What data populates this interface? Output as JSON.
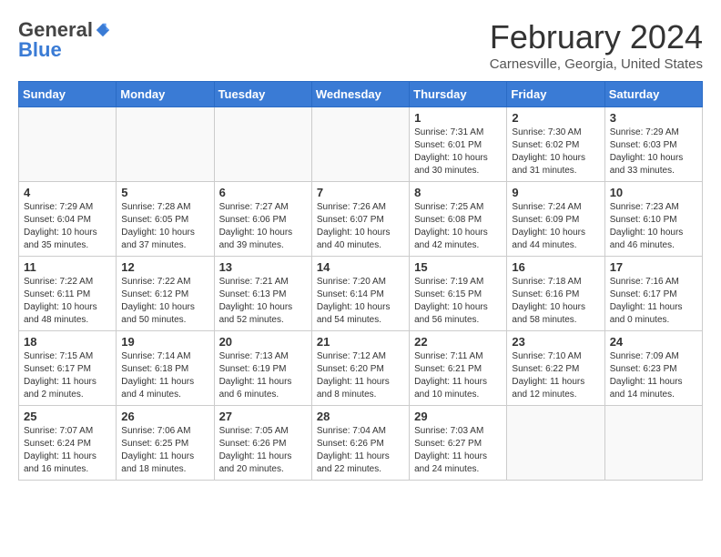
{
  "header": {
    "logo_general": "General",
    "logo_blue": "Blue",
    "month_title": "February 2024",
    "location": "Carnesville, Georgia, United States"
  },
  "weekdays": [
    "Sunday",
    "Monday",
    "Tuesday",
    "Wednesday",
    "Thursday",
    "Friday",
    "Saturday"
  ],
  "weeks": [
    [
      {
        "day": "",
        "info": ""
      },
      {
        "day": "",
        "info": ""
      },
      {
        "day": "",
        "info": ""
      },
      {
        "day": "",
        "info": ""
      },
      {
        "day": "1",
        "info": "Sunrise: 7:31 AM\nSunset: 6:01 PM\nDaylight: 10 hours\nand 30 minutes."
      },
      {
        "day": "2",
        "info": "Sunrise: 7:30 AM\nSunset: 6:02 PM\nDaylight: 10 hours\nand 31 minutes."
      },
      {
        "day": "3",
        "info": "Sunrise: 7:29 AM\nSunset: 6:03 PM\nDaylight: 10 hours\nand 33 minutes."
      }
    ],
    [
      {
        "day": "4",
        "info": "Sunrise: 7:29 AM\nSunset: 6:04 PM\nDaylight: 10 hours\nand 35 minutes."
      },
      {
        "day": "5",
        "info": "Sunrise: 7:28 AM\nSunset: 6:05 PM\nDaylight: 10 hours\nand 37 minutes."
      },
      {
        "day": "6",
        "info": "Sunrise: 7:27 AM\nSunset: 6:06 PM\nDaylight: 10 hours\nand 39 minutes."
      },
      {
        "day": "7",
        "info": "Sunrise: 7:26 AM\nSunset: 6:07 PM\nDaylight: 10 hours\nand 40 minutes."
      },
      {
        "day": "8",
        "info": "Sunrise: 7:25 AM\nSunset: 6:08 PM\nDaylight: 10 hours\nand 42 minutes."
      },
      {
        "day": "9",
        "info": "Sunrise: 7:24 AM\nSunset: 6:09 PM\nDaylight: 10 hours\nand 44 minutes."
      },
      {
        "day": "10",
        "info": "Sunrise: 7:23 AM\nSunset: 6:10 PM\nDaylight: 10 hours\nand 46 minutes."
      }
    ],
    [
      {
        "day": "11",
        "info": "Sunrise: 7:22 AM\nSunset: 6:11 PM\nDaylight: 10 hours\nand 48 minutes."
      },
      {
        "day": "12",
        "info": "Sunrise: 7:22 AM\nSunset: 6:12 PM\nDaylight: 10 hours\nand 50 minutes."
      },
      {
        "day": "13",
        "info": "Sunrise: 7:21 AM\nSunset: 6:13 PM\nDaylight: 10 hours\nand 52 minutes."
      },
      {
        "day": "14",
        "info": "Sunrise: 7:20 AM\nSunset: 6:14 PM\nDaylight: 10 hours\nand 54 minutes."
      },
      {
        "day": "15",
        "info": "Sunrise: 7:19 AM\nSunset: 6:15 PM\nDaylight: 10 hours\nand 56 minutes."
      },
      {
        "day": "16",
        "info": "Sunrise: 7:18 AM\nSunset: 6:16 PM\nDaylight: 10 hours\nand 58 minutes."
      },
      {
        "day": "17",
        "info": "Sunrise: 7:16 AM\nSunset: 6:17 PM\nDaylight: 11 hours\nand 0 minutes."
      }
    ],
    [
      {
        "day": "18",
        "info": "Sunrise: 7:15 AM\nSunset: 6:17 PM\nDaylight: 11 hours\nand 2 minutes."
      },
      {
        "day": "19",
        "info": "Sunrise: 7:14 AM\nSunset: 6:18 PM\nDaylight: 11 hours\nand 4 minutes."
      },
      {
        "day": "20",
        "info": "Sunrise: 7:13 AM\nSunset: 6:19 PM\nDaylight: 11 hours\nand 6 minutes."
      },
      {
        "day": "21",
        "info": "Sunrise: 7:12 AM\nSunset: 6:20 PM\nDaylight: 11 hours\nand 8 minutes."
      },
      {
        "day": "22",
        "info": "Sunrise: 7:11 AM\nSunset: 6:21 PM\nDaylight: 11 hours\nand 10 minutes."
      },
      {
        "day": "23",
        "info": "Sunrise: 7:10 AM\nSunset: 6:22 PM\nDaylight: 11 hours\nand 12 minutes."
      },
      {
        "day": "24",
        "info": "Sunrise: 7:09 AM\nSunset: 6:23 PM\nDaylight: 11 hours\nand 14 minutes."
      }
    ],
    [
      {
        "day": "25",
        "info": "Sunrise: 7:07 AM\nSunset: 6:24 PM\nDaylight: 11 hours\nand 16 minutes."
      },
      {
        "day": "26",
        "info": "Sunrise: 7:06 AM\nSunset: 6:25 PM\nDaylight: 11 hours\nand 18 minutes."
      },
      {
        "day": "27",
        "info": "Sunrise: 7:05 AM\nSunset: 6:26 PM\nDaylight: 11 hours\nand 20 minutes."
      },
      {
        "day": "28",
        "info": "Sunrise: 7:04 AM\nSunset: 6:26 PM\nDaylight: 11 hours\nand 22 minutes."
      },
      {
        "day": "29",
        "info": "Sunrise: 7:03 AM\nSunset: 6:27 PM\nDaylight: 11 hours\nand 24 minutes."
      },
      {
        "day": "",
        "info": ""
      },
      {
        "day": "",
        "info": ""
      }
    ]
  ]
}
